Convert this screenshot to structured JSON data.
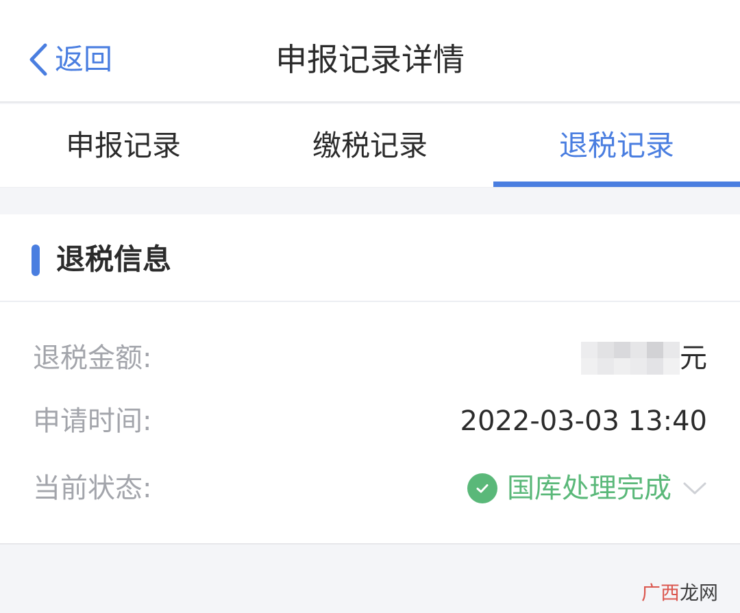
{
  "navbar": {
    "back_label": "返回",
    "title": "申报记录详情"
  },
  "tabs": [
    {
      "label": "申报记录",
      "active": false
    },
    {
      "label": "缴税记录",
      "active": false
    },
    {
      "label": "退税记录",
      "active": true
    }
  ],
  "section": {
    "title": "退税信息"
  },
  "details": {
    "refund_amount": {
      "label": "退税金额:",
      "value": "",
      "unit": "元"
    },
    "apply_time": {
      "label": "申请时间:",
      "value": "2022-03-03 13:40"
    },
    "status": {
      "label": "当前状态:",
      "value": "国库处理完成"
    }
  },
  "watermark": {
    "part1": "广西",
    "part2": "龙网"
  },
  "colors": {
    "accent": "#4a7ee0",
    "success": "#5ab879",
    "label_gray": "#a3a5ab",
    "background": "#f4f5f8"
  },
  "icons": [
    "chevron-left-icon",
    "check-circle-icon",
    "chevron-down-icon"
  ]
}
